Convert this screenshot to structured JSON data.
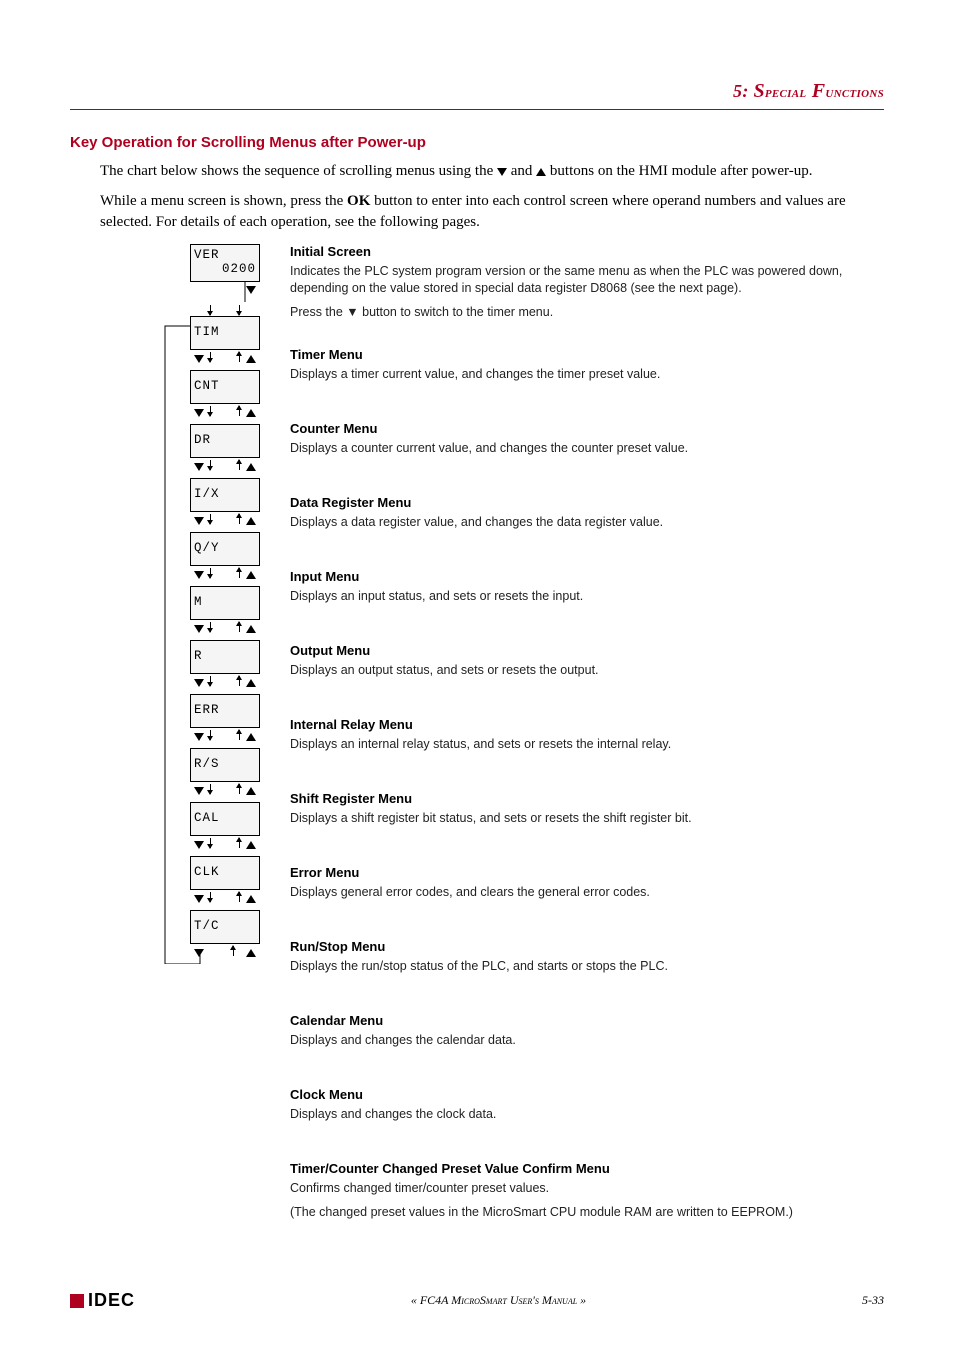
{
  "chapter": {
    "num": "5:",
    "title_pre": "S",
    "title_mid": "pecial",
    "title_pre2": " F",
    "title_mid2": "unctions"
  },
  "section_title": "Key Operation for Scrolling Menus after Power-up",
  "intro1_a": "The chart below shows the sequence of scrolling menus using the ",
  "intro1_b": " and ",
  "intro1_c": " buttons on the HMI module after power-up.",
  "intro2_a": "While a menu screen is shown, press the ",
  "intro2_ok": "OK",
  "intro2_b": " button to enter into each control screen where operand numbers and values are selected. For details of each operation, see the following pages.",
  "screens": {
    "ver_l1": "VER",
    "ver_l2": "0200",
    "tim": "TIM",
    "cnt": "CNT",
    "dr": "DR",
    "ix": "I/X",
    "qy": "Q/Y",
    "m": "M",
    "r": "R",
    "err": "ERR",
    "rs": "R/S",
    "cal": "CAL",
    "clk": "CLK",
    "tc": "T/C"
  },
  "menus": [
    {
      "key": "initial",
      "title": "Initial Screen",
      "text": [
        "Indicates the PLC system program version or the same menu as when the PLC was powered down, depending on the value stored in special data register D8068 (see the next page).",
        "Press the ▼ button to switch to the timer menu."
      ]
    },
    {
      "key": "timer",
      "title": "Timer Menu",
      "text": [
        "Displays a timer current value, and changes the timer preset value."
      ]
    },
    {
      "key": "counter",
      "title": "Counter Menu",
      "text": [
        "Displays a counter current value, and changes the counter preset value."
      ]
    },
    {
      "key": "datareg",
      "title": "Data Register Menu",
      "text": [
        "Displays a data register value, and changes the data register value."
      ]
    },
    {
      "key": "input",
      "title": "Input Menu",
      "text": [
        "Displays an input status, and sets or resets the input."
      ]
    },
    {
      "key": "output",
      "title": "Output Menu",
      "text": [
        "Displays an output status, and sets or resets the output."
      ]
    },
    {
      "key": "relay",
      "title": "Internal Relay Menu",
      "text": [
        "Displays an internal relay status, and sets or resets the internal relay."
      ]
    },
    {
      "key": "shift",
      "title": "Shift Register Menu",
      "text": [
        "Displays a shift register bit status, and sets or resets the shift register bit."
      ]
    },
    {
      "key": "error",
      "title": "Error Menu",
      "text": [
        "Displays general error codes, and clears the general error codes."
      ]
    },
    {
      "key": "runstop",
      "title": "Run/Stop Menu",
      "text": [
        "Displays the run/stop status of the PLC, and starts or stops the PLC."
      ]
    },
    {
      "key": "calendar",
      "title": "Calendar Menu",
      "text": [
        "Displays and changes the calendar data."
      ]
    },
    {
      "key": "clock",
      "title": "Clock Menu",
      "text": [
        "Displays and changes the clock data."
      ]
    },
    {
      "key": "tc",
      "title": "Timer/Counter Changed Preset Value Confirm Menu",
      "text": [
        "Confirms changed timer/counter preset values.",
        "(The changed preset values in the MicroSmart CPU module RAM are written to EEPROM.)"
      ]
    }
  ],
  "footer": {
    "logo": "IDEC",
    "center": "« FC4A MicroSmart User's Manual »",
    "page": "5-33"
  }
}
